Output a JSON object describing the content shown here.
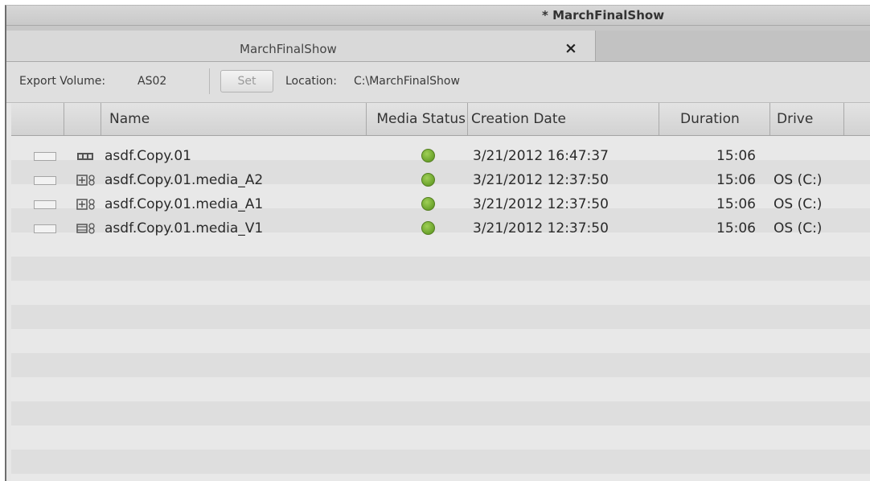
{
  "window": {
    "title": "* MarchFinalShow"
  },
  "tab": {
    "label": "MarchFinalShow",
    "close_glyph": "×",
    "close_icon": "close-icon"
  },
  "toolbar": {
    "export_volume_label": "Export Volume:",
    "export_volume_value": "AS02",
    "set_label": "Set",
    "location_label": "Location:",
    "location_value": "C:\\MarchFinalShow"
  },
  "columns": [
    "",
    "",
    "Name",
    "Media Status",
    "Creation Date",
    "Duration",
    "Drive"
  ],
  "rows": [
    {
      "icon": "sequence-icon",
      "name": "asdf.Copy.01",
      "status": "online",
      "created": "3/21/2012 16:47:37",
      "duration": "15:06",
      "drive": ""
    },
    {
      "icon": "audio-clip-icon",
      "name": "asdf.Copy.01.media_A2",
      "status": "online",
      "created": "3/21/2012 12:37:50",
      "duration": "15:06",
      "drive": "OS (C:)"
    },
    {
      "icon": "audio-clip-icon",
      "name": "asdf.Copy.01.media_A1",
      "status": "online",
      "created": "3/21/2012 12:37:50",
      "duration": "15:06",
      "drive": "OS (C:)"
    },
    {
      "icon": "video-clip-icon",
      "name": "asdf.Copy.01.media_V1",
      "status": "online",
      "created": "3/21/2012 12:37:50",
      "duration": "15:06",
      "drive": "OS (C:)"
    }
  ],
  "colors": {
    "status_online": "#7aae32",
    "window_bg": "#e7e7e7",
    "header_bg": "#d8d8d8"
  }
}
